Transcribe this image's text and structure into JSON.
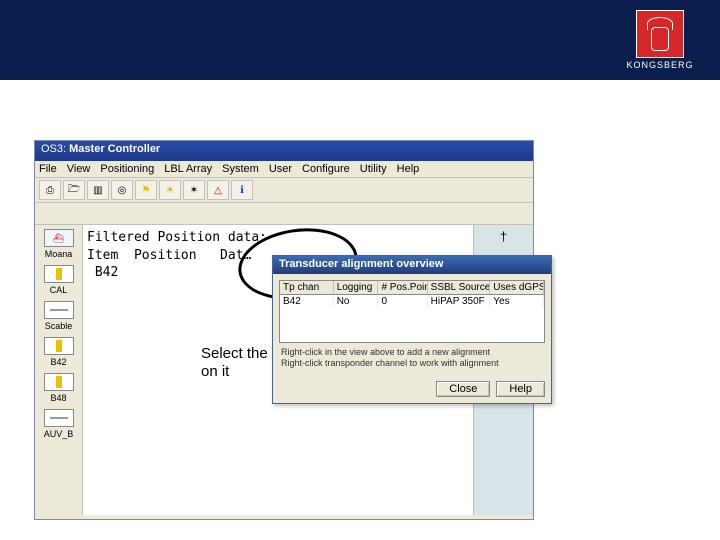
{
  "banner": {
    "brand": "KONGSBERG"
  },
  "window": {
    "title_prefix": "OS3:",
    "title": "Master Controller"
  },
  "menubar": [
    "File",
    "View",
    "Positioning",
    "LBL Array",
    "System",
    "User",
    "Configure",
    "Utility",
    "Help"
  ],
  "toolbar_icons": [
    {
      "name": "print-icon",
      "glyph": "⎙"
    },
    {
      "name": "open-icon",
      "glyph": "🗁"
    },
    {
      "name": "cfg-icon",
      "glyph": "▥"
    },
    {
      "name": "target-icon",
      "glyph": "◎"
    },
    {
      "name": "flag-icon",
      "glyph": "⚑",
      "color": "#e6c200"
    },
    {
      "name": "sun-icon",
      "glyph": "☀",
      "color": "#d4a800"
    },
    {
      "name": "gear-icon",
      "glyph": "✶"
    },
    {
      "name": "warning-icon",
      "glyph": "△",
      "color": "#d40000"
    },
    {
      "name": "info-icon",
      "glyph": "ℹ",
      "color": "#1040c0"
    }
  ],
  "rail": [
    {
      "label": "Moana",
      "icon": "ship"
    },
    {
      "label": "CAL",
      "icon": "bar"
    },
    {
      "label": "Scable",
      "icon": "dash"
    },
    {
      "label": "B42",
      "icon": "bar"
    },
    {
      "label": "B48",
      "icon": "bar"
    },
    {
      "label": "AUV_B",
      "icon": "dash"
    }
  ],
  "main_text": {
    "line1": "Filtered Position data:",
    "line2": "Item  Position   Dat…",
    "line3": " B42"
  },
  "annotation": "Select the transponder, and right click on it",
  "popup": {
    "title": "Transducer alignment overview",
    "columns": [
      "Tp chan",
      "Logging",
      "# Pos.Point",
      "SSBL Source",
      "Uses dGPS"
    ],
    "row": [
      "B42",
      "No",
      "0",
      "HiPAP 350F",
      "Yes"
    ],
    "hint1": "Right-click in the view above to add a new alignment",
    "hint2": "Right-click transponder channel to work with alignment",
    "close": "Close",
    "help": "Help"
  },
  "right_pad_marker": "†"
}
